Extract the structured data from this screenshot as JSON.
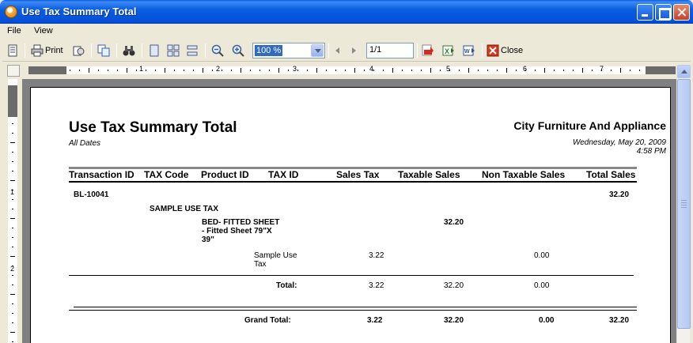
{
  "window": {
    "title": "Use Tax Summary Total",
    "app_icon": "report-viewer-icon"
  },
  "menubar": {
    "items": [
      "File",
      "View"
    ]
  },
  "toolbar": {
    "print_label": "Print",
    "zoom_value": "100 %",
    "page_value": "1/1",
    "close_label": "Close"
  },
  "ruler": {
    "numbers": [
      "1",
      "2",
      "3",
      "4",
      "5",
      "6",
      "7"
    ],
    "vnumbers": [
      "1",
      "2"
    ]
  },
  "report": {
    "title": "Use Tax Summary Total",
    "dates": "All Dates",
    "company": "City Furniture And Appliance",
    "date_line1": "Wednesday, May 20, 2009",
    "date_line2": "4:58 PM",
    "columns": [
      "Transaction ID",
      "TAX Code",
      "Product ID",
      "TAX ID",
      "Sales Tax",
      "Taxable Sales",
      "Non Taxable Sales",
      "Total Sales"
    ],
    "transaction": {
      "id": "BL-10041",
      "total_sales": "32.20"
    },
    "tax_code": "SAMPLE USE TAX",
    "product": {
      "line1": "BED- FITTED SHEET",
      "line2": "- Fitted Sheet 79\"X",
      "line3": "39\"",
      "taxable_sales": "32.20"
    },
    "tax_row": {
      "name_line1": "Sample Use",
      "name_line2": "Tax",
      "sales_tax": "3.22",
      "non_taxable": "0.00"
    },
    "total_row": {
      "label": "Total:",
      "sales_tax": "3.22",
      "taxable_sales": "32.20",
      "non_taxable": "0.00"
    },
    "grand_total": {
      "label": "Grand Total:",
      "sales_tax": "3.22",
      "taxable_sales": "32.20",
      "non_taxable": "0.00",
      "total_sales": "32.20"
    }
  }
}
